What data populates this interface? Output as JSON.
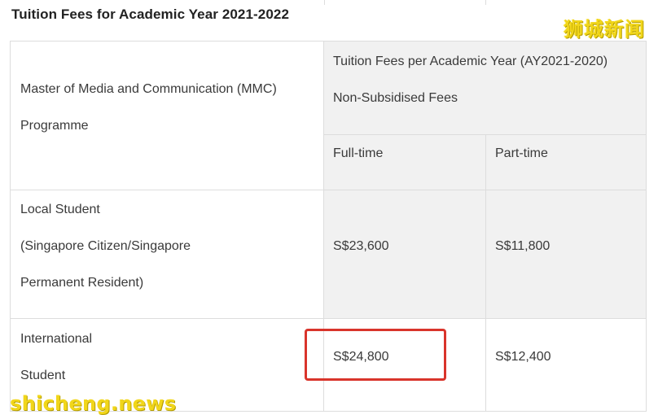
{
  "heading": "Tuition Fees for Academic Year 2021-2022",
  "header": {
    "programme_line1": "Master of Media and Communication (MMC)",
    "programme_line2": "Programme",
    "fees_title": "Tuition Fees per Academic Year (AY2021-2020)",
    "fees_subtitle": "Non-Subsidised Fees",
    "full_time": "Full-time",
    "part_time": "Part-time"
  },
  "rows": [
    {
      "label_lines": [
        "Local Student",
        "(Singapore Citizen/Singapore",
        "Permanent Resident)"
      ],
      "full_time": "S$23,600",
      "part_time": "S$11,800"
    },
    {
      "label_lines": [
        "International",
        "Student"
      ],
      "full_time": "S$24,800",
      "part_time": "S$12,400"
    }
  ],
  "highlight_color": "#d9342b",
  "watermarks": {
    "cn": "狮城新闻",
    "en": "shicheng.news"
  }
}
